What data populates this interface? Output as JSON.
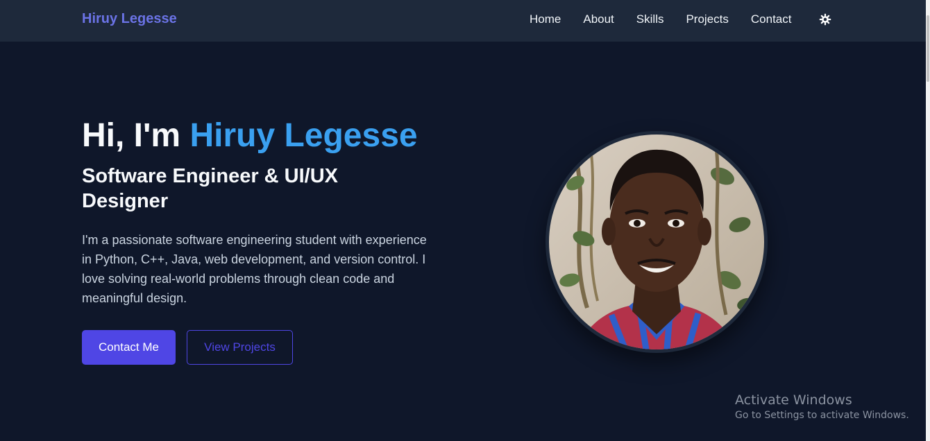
{
  "nav": {
    "brand": "Hiruy Legesse",
    "links": [
      "Home",
      "About",
      "Skills",
      "Projects",
      "Contact"
    ],
    "theme_icon": "gear-icon"
  },
  "hero": {
    "greeting": "Hi, I'm ",
    "name": "Hiruy Legesse",
    "subtitle": "Software Engineer & UI/UX Designer",
    "description": "I'm a passionate software engineering student with experience in Python, C++, Java, web development, and version control. I love solving real-world problems through clean code and meaningful design.",
    "primary_button": "Contact Me",
    "secondary_button": "View Projects"
  },
  "watermark": {
    "title": "Activate Windows",
    "subtitle": "Go to Settings to activate Windows."
  },
  "colors": {
    "background": "#0f172a",
    "navbar": "#1e293b",
    "brand": "#6b73e6",
    "accent": "#3aa0f0",
    "button": "#4f46e5"
  }
}
